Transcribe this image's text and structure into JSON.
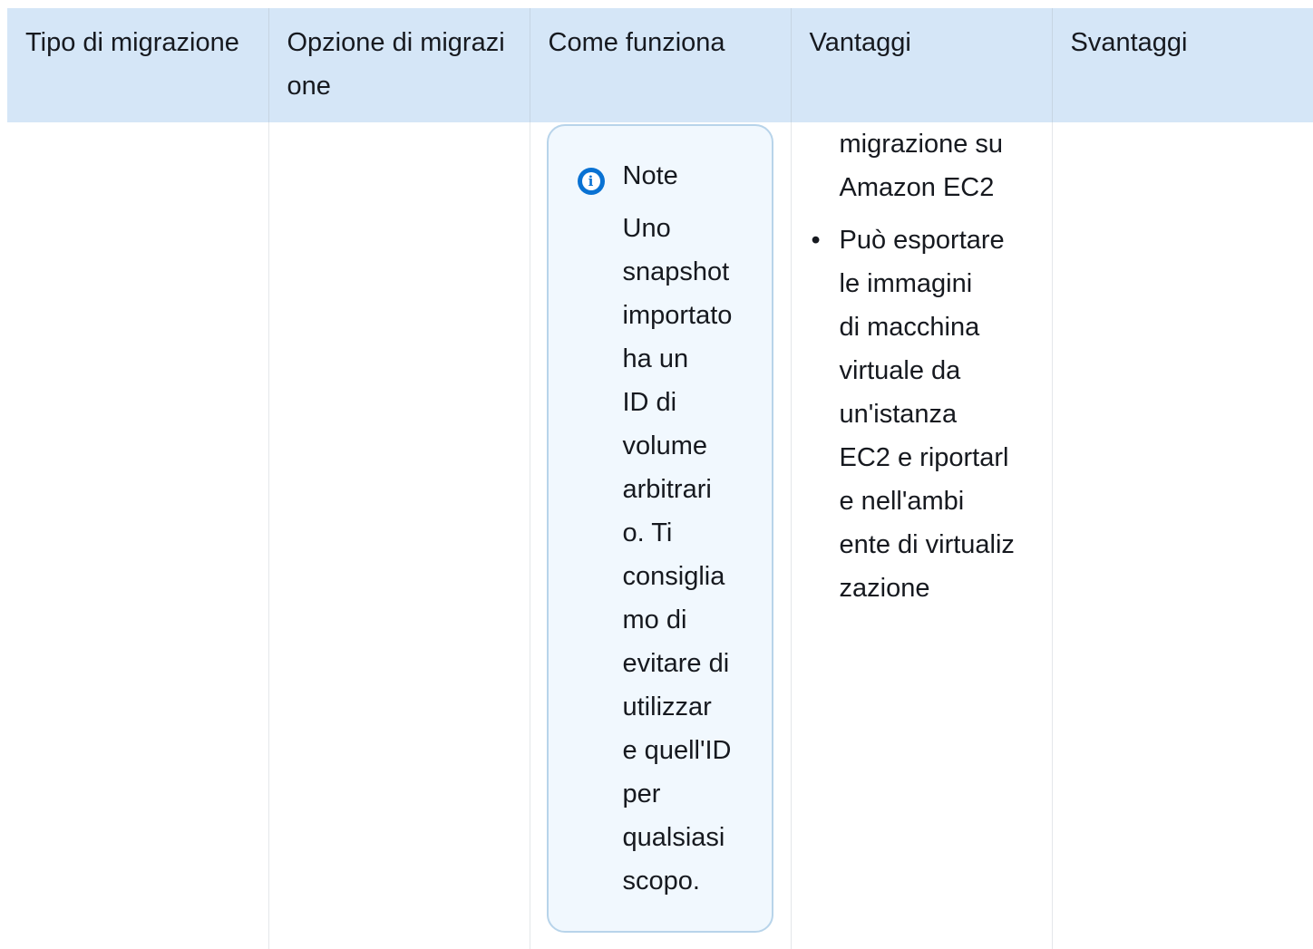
{
  "table": {
    "headers": [
      "Tipo di migrazione",
      "Opzione di migrazione",
      "Come funziona",
      "Vantaggi",
      "Svantaggi"
    ]
  },
  "note": {
    "icon": "info-icon",
    "title": "Note",
    "body": "Uno\nsnapshot\nimportato\nha un\nID di\nvolume\narbitrari\no. Ti\nconsiglia\nmo di\nevitare di\nutilizzar\ne quell'ID\nper\nqualsiasi\nscopo."
  },
  "vantaggi": {
    "continued": "migrazione su\nAmazon EC2",
    "items": [
      "Può esportare\nle immagini\ndi macchina\nvirtuale da\nun'istanza\nEC2 e riportarl\ne nell'ambi\nente di virtualiz\nzazione"
    ]
  },
  "colors": {
    "header_bg": "#d5e6f7",
    "note_bg": "#f1f8fe",
    "note_border": "#b8d4ea",
    "info_icon": "#0972d3"
  }
}
